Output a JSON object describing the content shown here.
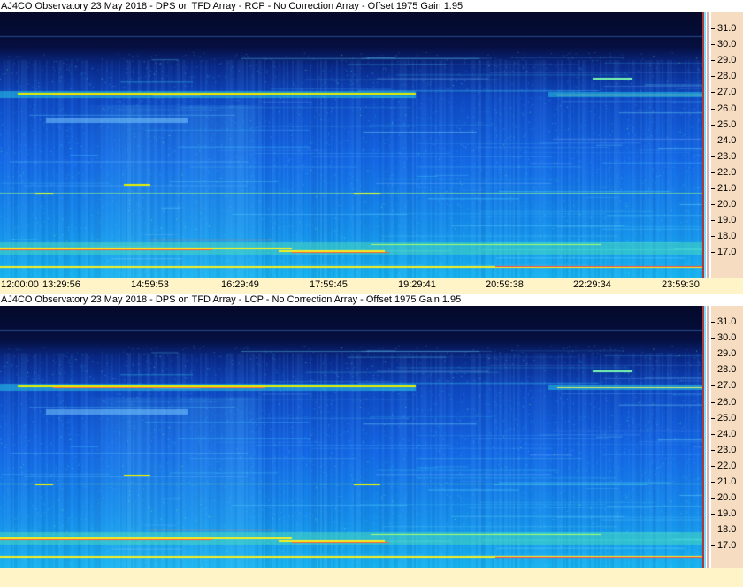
{
  "top_panel": {
    "title": "AJ4CO Observatory 23 May 2018 - DPS on TFD Array  - RCP  -  No Correction Array  -  Offset 1975  Gain 1.95"
  },
  "bottom_panel": {
    "title": "AJ4CO Observatory 23 May 2018 - DPS on TFD Array  - LCP  -  No Correction Array  -  Offset 1975  Gain 1.95"
  },
  "frequency_scale": {
    "labels": [
      "31.0",
      "30.0",
      "29.0",
      "28.0",
      "27.0",
      "26.0",
      "25.0",
      "24.0",
      "23.0",
      "22.0",
      "21.0",
      "20.0",
      "19.0",
      "18.0",
      "17.0"
    ]
  },
  "time_axis": {
    "labels": [
      "12:00:00",
      "13:29:56",
      "14:59:53",
      "16:29:49",
      "17:59:45",
      "19:29:41",
      "20:59:38",
      "22:29:34",
      "23:59:30"
    ]
  },
  "colors": {
    "spectrogram_dark": "#050a2a",
    "spectrogram_mid": "#1568e6",
    "spectrogram_bright": "#18b4f0",
    "burst_line": "#f0f000",
    "scale_background": "#f6dcc0",
    "axis_background": "#fff3c8"
  }
}
